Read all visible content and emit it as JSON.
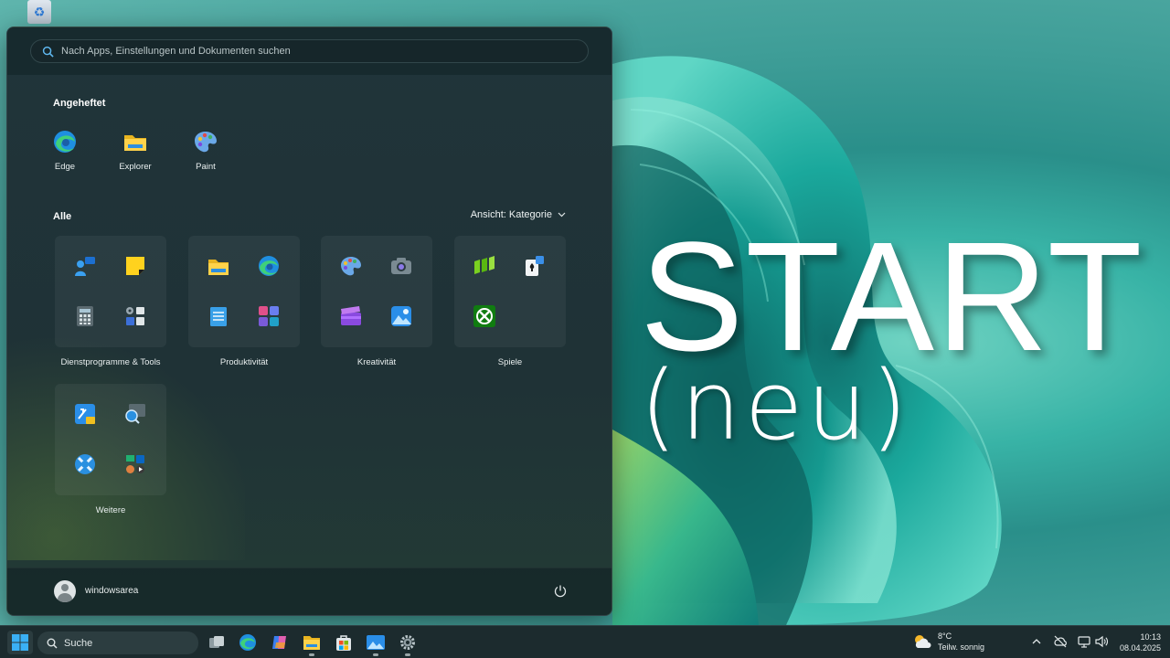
{
  "hero": {
    "title": "START",
    "subtitle": "(neu)"
  },
  "search": {
    "placeholder": "Nach Apps, Einstellungen und Dokumenten suchen"
  },
  "pinned": {
    "label": "Angeheftet",
    "apps": [
      {
        "label": "Edge",
        "icon": "edge-icon"
      },
      {
        "label": "Explorer",
        "icon": "folder-icon"
      },
      {
        "label": "Paint",
        "icon": "paint-palette-icon"
      }
    ]
  },
  "all": {
    "label": "Alle",
    "view_label": "Ansicht: Kategorie",
    "categories": [
      {
        "label": "Dienstprogramme & Tools",
        "icons": [
          "quick-assist-icon",
          "sticky-notes-icon",
          "calculator-icon",
          "tools-group-icon"
        ]
      },
      {
        "label": "Produktivität",
        "icons": [
          "folder-icon",
          "edge-icon",
          "notepad-icon",
          "office-apps-icon"
        ]
      },
      {
        "label": "Kreativität",
        "icons": [
          "paint-palette-icon",
          "camera-icon",
          "clipchamp-icon",
          "photos-icon"
        ]
      },
      {
        "label": "Spiele",
        "icons": [
          "gamepass-icon",
          "solitaire-icon",
          "xbox-icon"
        ]
      },
      {
        "label": "Weitere",
        "icons": [
          "snipping-tool-icon",
          "magnifier-icon",
          "accessibility-icon",
          "more-apps-icon"
        ]
      }
    ]
  },
  "user": {
    "name": "windowsarea"
  },
  "taskbar": {
    "search_label": "Suche",
    "weather": {
      "temp": "8°C",
      "condition": "Teilw. sonnig"
    },
    "time": "10:13",
    "date": "08.04.2025"
  },
  "colors": {
    "accent": "#1a8bd8",
    "menu_bg": "#20343a",
    "taskbar_bg": "#1c2b2e"
  }
}
